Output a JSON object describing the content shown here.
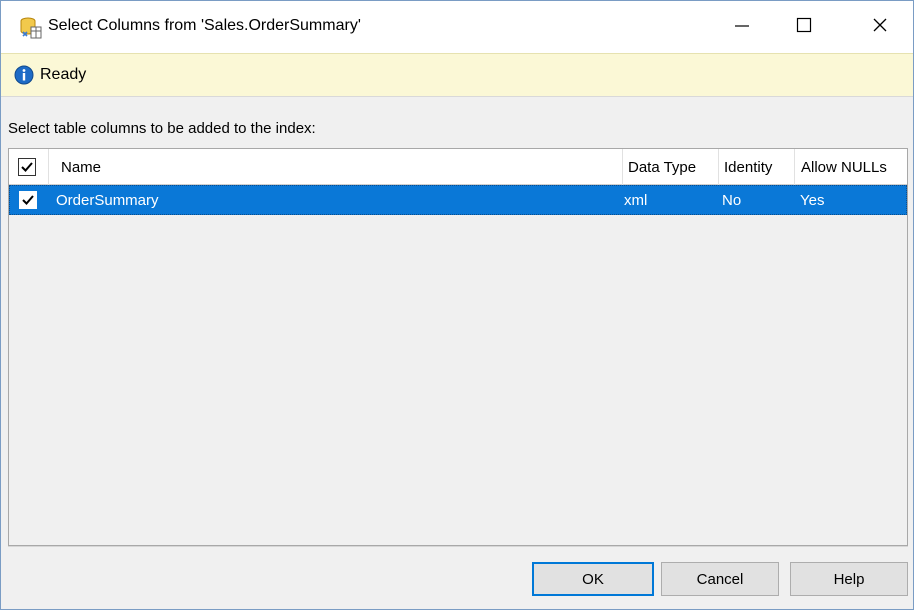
{
  "window": {
    "title": "Select Columns from 'Sales.OrderSummary'",
    "app_icon": "database-columns-icon",
    "minimize_icon": "minimize-icon",
    "maximize_icon": "maximize-icon",
    "close_icon": "close-icon"
  },
  "status": {
    "icon": "info-icon",
    "text": "Ready"
  },
  "prompt": "Select table columns to be added to the index:",
  "grid": {
    "header_checked": true,
    "columns": [
      "Name",
      "Data Type",
      "Identity",
      "Allow NULLs"
    ],
    "rows": [
      {
        "checked": true,
        "selected": true,
        "name": "OrderSummary",
        "data_type": "xml",
        "identity": "No",
        "allow_nulls": "Yes"
      }
    ]
  },
  "buttons": {
    "ok": "OK",
    "cancel": "Cancel",
    "help": "Help"
  },
  "colors": {
    "selection": "#0a78d7",
    "status_background": "#fbf8d6",
    "info_icon": "#1e6bc6"
  }
}
